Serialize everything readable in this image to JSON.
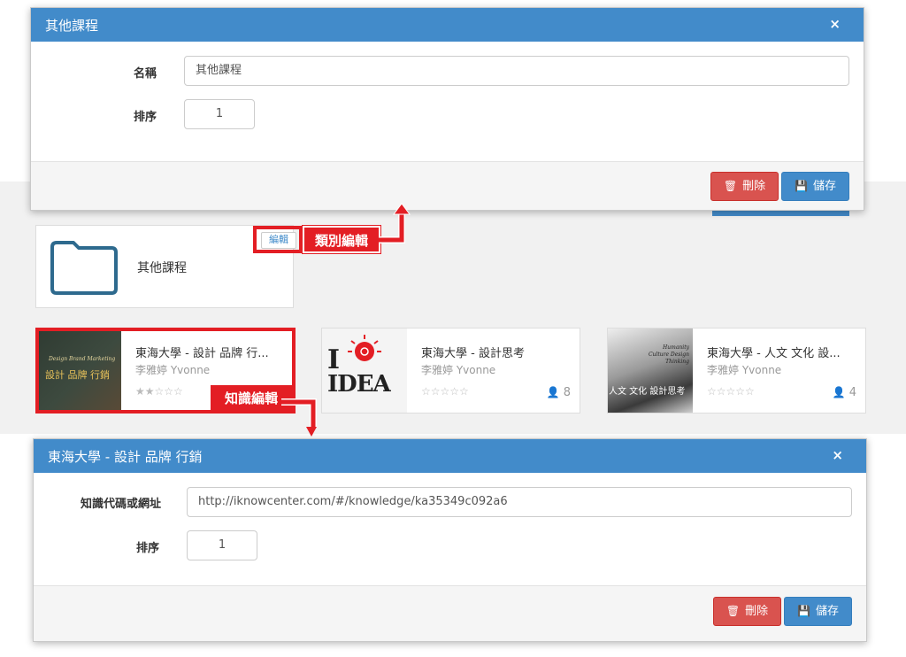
{
  "category_modal": {
    "title": "其他課程",
    "close": "×",
    "name_label": "名稱",
    "name_value": "其他課程",
    "order_label": "排序",
    "order_value": "1",
    "delete_label": "刪除",
    "save_label": "儲存"
  },
  "folder_card": {
    "edit_label": "編輯",
    "name": "其他課程"
  },
  "annotations": {
    "category_edit": "類別編輯",
    "knowledge_edit": "知識編輯"
  },
  "courses": [
    {
      "title": "東海大學 - 設計 品牌 行...",
      "author": "李雅婷 Yvonne",
      "stars": "★★☆☆☆",
      "rating": 2,
      "count": "",
      "thumb_text_1": "Design Brand Marketing",
      "thumb_text_2": "設計 品牌 行銷"
    },
    {
      "title": "東海大學 - 設計思考",
      "author": "李雅婷 Yvonne",
      "stars": "☆☆☆☆☆",
      "rating": 0,
      "count": "8",
      "thumb_text_1": "I",
      "thumb_text_2": "IDEA"
    },
    {
      "title": "東海大學 - 人文 文化 設...",
      "author": "李雅婷 Yvonne",
      "stars": "☆☆☆☆☆",
      "rating": 0,
      "count": "4",
      "thumb_text_1": "Humanity Culture Design Thinking",
      "thumb_text_2": "人文 文化 設計思考"
    }
  ],
  "knowledge_modal": {
    "title": "東海大學 - 設計 品牌 行銷",
    "close": "×",
    "url_label": "知識代碼或網址",
    "url_value": "http://iknowcenter.com/#/knowledge/ka35349c092a6",
    "order_label": "排序",
    "order_value": "1",
    "delete_label": "刪除",
    "save_label": "儲存"
  },
  "colors": {
    "header_blue": "#428bca",
    "danger_red": "#d9534f",
    "annotation_red": "#e31e24",
    "folder_stroke": "#2e6a8e"
  }
}
